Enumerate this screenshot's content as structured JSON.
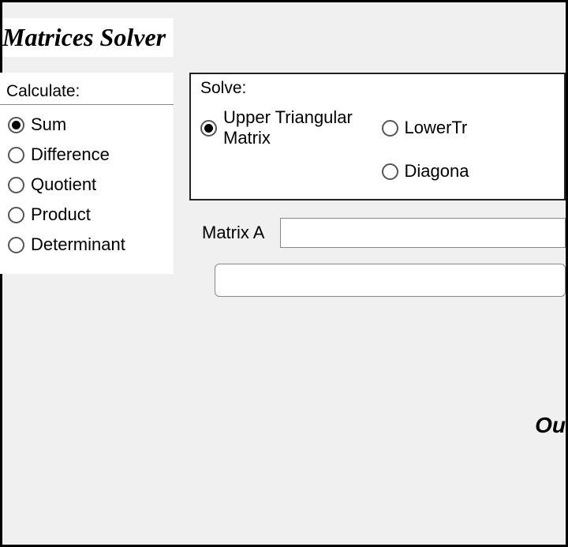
{
  "title": "Matrices Solver",
  "calculate": {
    "header": "Calculate:",
    "options": [
      {
        "key": "sum",
        "label": "Sum",
        "selected": true
      },
      {
        "key": "difference",
        "label": "Difference",
        "selected": false
      },
      {
        "key": "quotient",
        "label": "Quotient",
        "selected": false
      },
      {
        "key": "product",
        "label": "Product",
        "selected": false
      },
      {
        "key": "determinant",
        "label": "Determinant",
        "selected": false
      }
    ]
  },
  "solve": {
    "header": "Solve:",
    "options": [
      {
        "key": "upper",
        "label": "Upper Triangular Matrix",
        "selected": true
      },
      {
        "key": "lower",
        "label": "LowerTr",
        "selected": false
      },
      {
        "key": "blank",
        "label": "",
        "selected": false,
        "hidden": true
      },
      {
        "key": "diagonal",
        "label": "Diagona",
        "selected": false
      }
    ]
  },
  "matrixA": {
    "label": "Matrix A",
    "value": ""
  },
  "secondInput": {
    "value": ""
  },
  "output": {
    "label": "Ou"
  }
}
